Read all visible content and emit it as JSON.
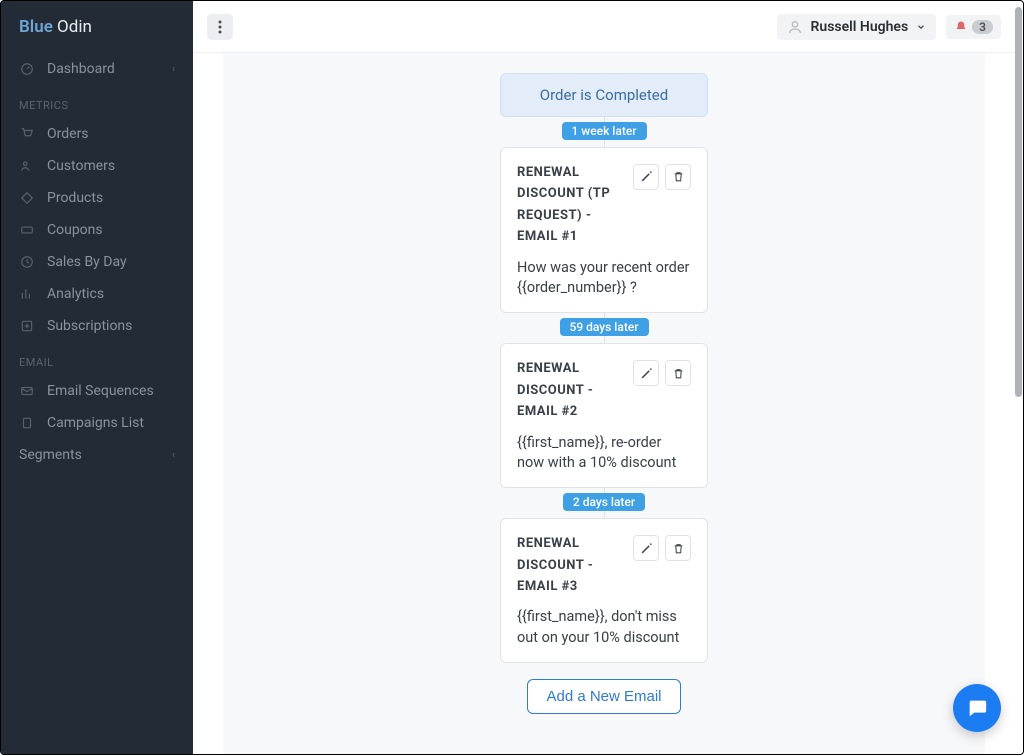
{
  "brand": {
    "blue": "Blue",
    "odin": " Odin"
  },
  "sidebar": {
    "dashboard": "Dashboard",
    "metrics_header": "METRICS",
    "orders": "Orders",
    "customers": "Customers",
    "products": "Products",
    "coupons": "Coupons",
    "sales_by_day": "Sales By Day",
    "analytics": "Analytics",
    "subscriptions": "Subscriptions",
    "email_header": "EMAIL",
    "email_sequences": "Email Sequences",
    "campaigns_list": "Campaigns List",
    "segments": "Segments"
  },
  "topbar": {
    "user_name": "Russell Hughes",
    "notif_count": "3"
  },
  "flow": {
    "trigger": "Order is Completed",
    "add_email": "Add a New Email",
    "steps": [
      {
        "delay": "1 week later",
        "title": "RENEWAL DISCOUNT (TP REQUEST) - EMAIL #1",
        "subject": "How was your recent order {{order_number}} ?"
      },
      {
        "delay": "59 days later",
        "title": "RENEWAL DISCOUNT - EMAIL #2",
        "subject": "{{first_name}}, re-order now with a 10% discount"
      },
      {
        "delay": "2 days later",
        "title": "RENEWAL DISCOUNT - EMAIL #3",
        "subject": "{{first_name}}, don't miss out on your 10% discount"
      }
    ]
  }
}
